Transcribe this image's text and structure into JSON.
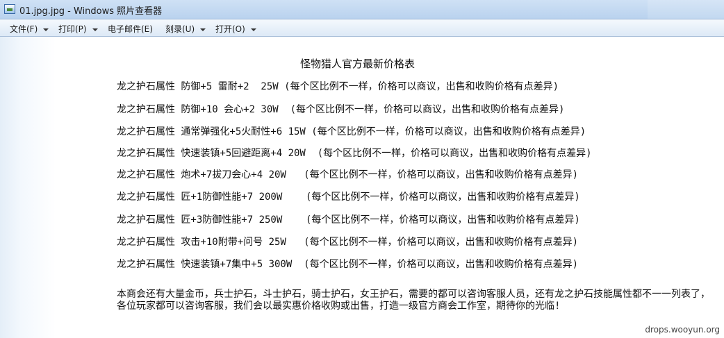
{
  "window": {
    "title": "01.jpg.jpg - Windows 照片查看器"
  },
  "menu": [
    {
      "label": "文件(F)"
    },
    {
      "label": "打印(P)"
    },
    {
      "label": "电子邮件(E)"
    },
    {
      "label": "刻录(U)"
    },
    {
      "label": "打开(O)"
    }
  ],
  "image": {
    "title": "怪物猎人官方最新价格表",
    "rows": [
      "龙之护石属性 防御+5 雷耐+2  25W (每个区比例不一样，价格可以商议，出售和收购价格有点差异)",
      "龙之护石属性 防御+10 会心+2 30W  (每个区比例不一样，价格可以商议，出售和收购价格有点差异)",
      "龙之护石属性 通常弹强化+5火耐性+6 15W (每个区比例不一样，价格可以商议，出售和收购价格有点差异)",
      "龙之护石属性 快速装镇+5回避距离+4 20W  (每个区比例不一样，价格可以商议，出售和收购价格有点差异)",
      "龙之护石属性 炮术+7拔刀会心+4 20W   (每个区比例不一样，价格可以商议，出售和收购价格有点差异)",
      "龙之护石属性 匠+1防御性能+7 200W    (每个区比例不一样，价格可以商议，出售和收购价格有点差异)",
      "龙之护石属性 匠+3防御性能+7 250W    (每个区比例不一样，价格可以商议，出售和收购价格有点差异)",
      "龙之护石属性 攻击+10附带+问号 25W   (每个区比例不一样，价格可以商议，出售和收购价格有点差异)",
      "龙之护石属性 快速装镇+7集中+5 300W  (每个区比例不一样，价格可以商议，出售和收购价格有点差异)"
    ],
    "paragraph": "本商会还有大量金币，兵士护石，斗士护石，骑士护石，女王护石，需要的都可以咨询客服人员，还有龙之护石技能属性都不一一列表了，各位玩家都可以咨询客服，我们会以最实惠价格收购或出售，打造一级官方商会工作室，期待你的光临!",
    "watermark": "drops.wooyun.org"
  }
}
